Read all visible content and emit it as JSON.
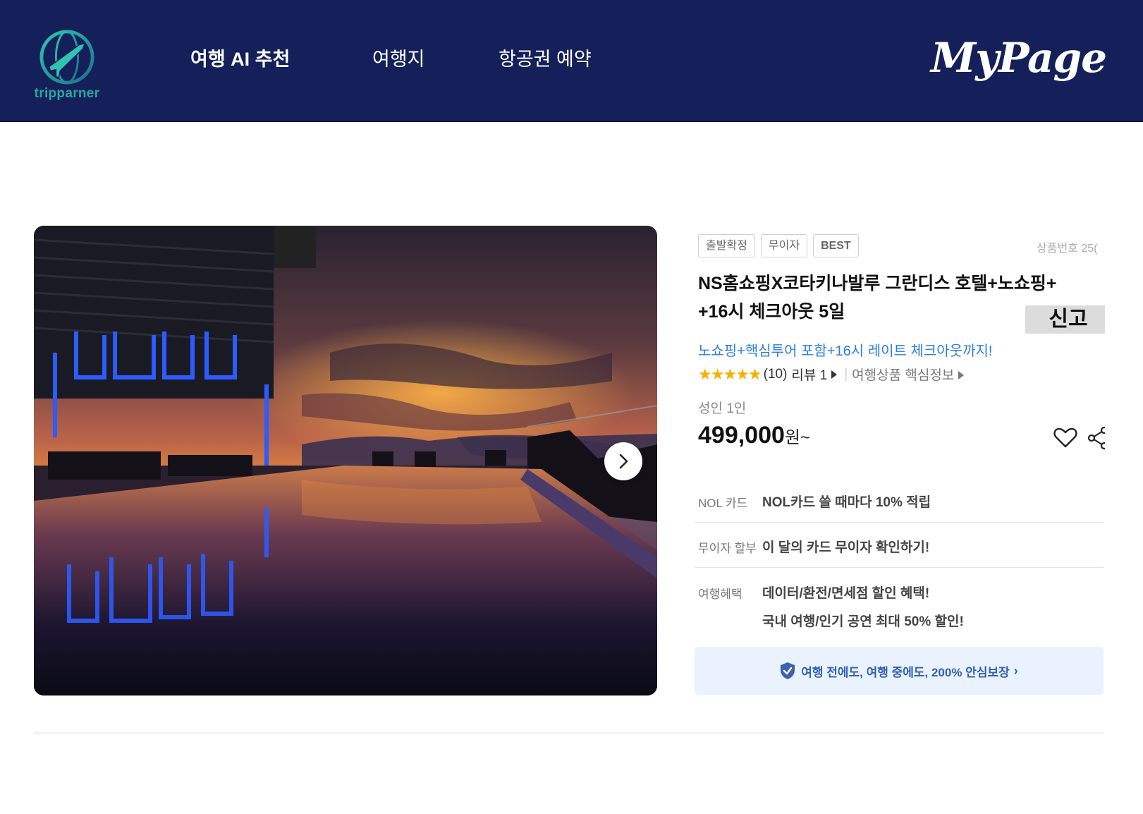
{
  "header": {
    "logo_text": "tripparner",
    "nav": {
      "ai": "여행 AI 추천",
      "destination": "여행지",
      "flight": "항공권 예약"
    },
    "mypage": "MyPage"
  },
  "product": {
    "badges": [
      "출발확정",
      "무이자",
      "BEST"
    ],
    "product_no": "상품번호 25(",
    "title_line1": "NS홈쇼핑X코타키나발루 그란디스 호텔+노쇼핑+",
    "title_line2": "+16시 체크아웃 5일",
    "report": "신고",
    "subtitle": "노쇼핑+핵심투어 포함+16시 레이트 체크아웃까지!",
    "rating_stars": "★★★★★",
    "rating_count": "(10)",
    "review_label": "리뷰 1",
    "info_link": "여행상품 핵심정보",
    "adult_label": "성인 1인",
    "price": "499,000",
    "price_unit": "원~",
    "rows": {
      "nol_label": "NOL 카드",
      "nol_value": "NOL카드 쓸 때마다 10% 적립",
      "installment_label": "무이자 할부",
      "installment_value": "이 달의 카드 무이자 확인하기!",
      "benefit_label": "여행혜택",
      "benefit_value1": "데이터/환전/면세점 할인 혜택!",
      "benefit_value2": "국내 여행/인기 공연 최대 50% 할인!"
    },
    "guarantee": "여행 전에도, 여행 중에도, 200% 안심보장"
  },
  "colors": {
    "header_bg": "#15205a",
    "accent_blue": "#2a7de1",
    "star": "#f5b100",
    "guarantee_bg": "#eaf2fe"
  },
  "icons": [
    "globe-plane-logo-icon",
    "chevron-right-icon",
    "heart-icon",
    "share-icon",
    "shield-check-icon",
    "star-icon"
  ]
}
